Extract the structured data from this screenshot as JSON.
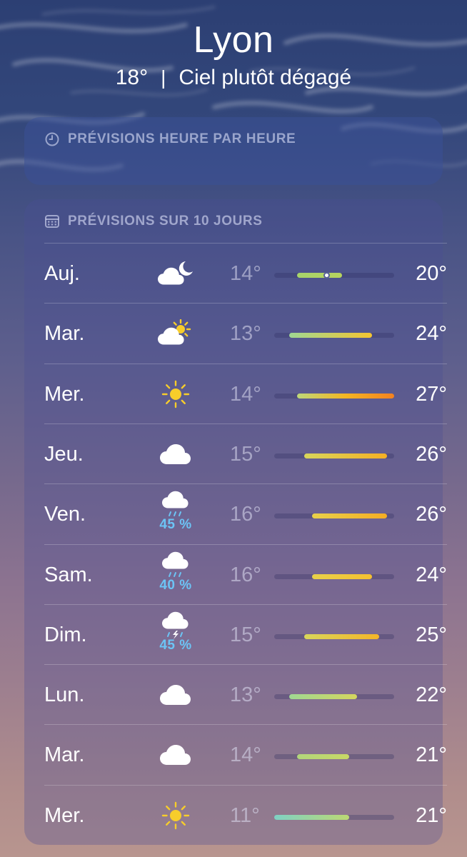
{
  "location": {
    "city": "Lyon",
    "current_temp": "18°",
    "separator": "|",
    "condition": "Ciel plutôt dégagé"
  },
  "hourly": {
    "title": "PRÉVISIONS HEURE PAR HEURE",
    "icon": "clock-icon"
  },
  "daily": {
    "title": "PRÉVISIONS SUR 10 JOURS",
    "icon": "calendar-icon",
    "scale": {
      "min": 11,
      "max": 27
    },
    "current_marker": 18,
    "days": [
      {
        "day": "Auj.",
        "icon": "cloud-moon-icon",
        "precip": "",
        "low": "14°",
        "high": "20°",
        "low_v": 14,
        "high_v": 20,
        "grad": [
          "#a6d46b",
          "#b7d45e"
        ]
      },
      {
        "day": "Mar.",
        "icon": "cloud-sun-icon",
        "precip": "",
        "low": "13°",
        "high": "24°",
        "low_v": 13,
        "high_v": 24,
        "grad": [
          "#9fd893",
          "#f5c531"
        ]
      },
      {
        "day": "Mer.",
        "icon": "sun-icon",
        "precip": "",
        "low": "14°",
        "high": "27°",
        "low_v": 14,
        "high_v": 27,
        "grad": [
          "#bed87a",
          "#f4b623",
          "#f4821f"
        ]
      },
      {
        "day": "Jeu.",
        "icon": "cloud-icon",
        "precip": "",
        "low": "15°",
        "high": "26°",
        "low_v": 15,
        "high_v": 26,
        "grad": [
          "#d8d65b",
          "#f5b024"
        ]
      },
      {
        "day": "Ven.",
        "icon": "cloud-rain-icon",
        "precip": "45 %",
        "low": "16°",
        "high": "26°",
        "low_v": 16,
        "high_v": 26,
        "grad": [
          "#e8d14a",
          "#f5ad24"
        ]
      },
      {
        "day": "Sam.",
        "icon": "cloud-rain-icon",
        "precip": "40 %",
        "low": "16°",
        "high": "24°",
        "low_v": 16,
        "high_v": 24,
        "grad": [
          "#e8d14a",
          "#f5c030"
        ]
      },
      {
        "day": "Dim.",
        "icon": "cloud-bolt-rain-icon",
        "precip": "45 %",
        "low": "15°",
        "high": "25°",
        "low_v": 15,
        "high_v": 25,
        "grad": [
          "#d8d65b",
          "#f5b528"
        ]
      },
      {
        "day": "Lun.",
        "icon": "cloud-icon",
        "precip": "",
        "low": "13°",
        "high": "22°",
        "low_v": 13,
        "high_v": 22,
        "grad": [
          "#9fd893",
          "#d5d65e"
        ]
      },
      {
        "day": "Mar.",
        "icon": "cloud-icon",
        "precip": "",
        "low": "14°",
        "high": "21°",
        "low_v": 14,
        "high_v": 21,
        "grad": [
          "#b2d67c",
          "#c8d865"
        ]
      },
      {
        "day": "Mer.",
        "icon": "sun-icon",
        "precip": "",
        "low": "11°",
        "high": "21°",
        "low_v": 11,
        "high_v": 21,
        "grad": [
          "#7fd1c4",
          "#bcd873"
        ]
      }
    ]
  }
}
